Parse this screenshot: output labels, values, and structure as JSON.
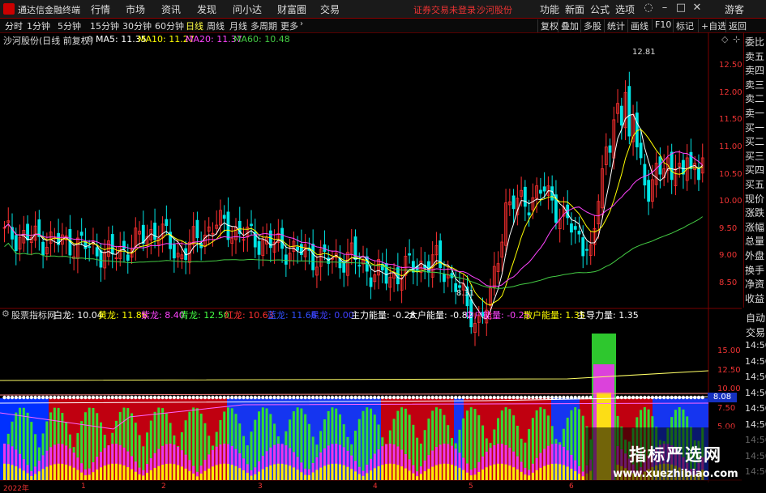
{
  "app": {
    "title": "通达信金融终端"
  },
  "menu": [
    "行情",
    "市场",
    "资讯",
    "发现",
    "问小达",
    "财富圈",
    "交易"
  ],
  "notice": {
    "text": "证券交易未登录",
    "stock": "沙河股份"
  },
  "right_menu": [
    "功能",
    "新面",
    "公式",
    "选项"
  ],
  "guest": "游客",
  "periods": [
    "分时",
    "1分钟",
    "5分钟",
    "15分钟",
    "30分钟",
    "60分钟",
    "日线",
    "周线",
    "月线",
    "多周期",
    "更多"
  ],
  "active_period": "日线",
  "right_tools": [
    "复权",
    "叠加",
    "多股",
    "统计",
    "画线",
    "F10",
    "标记",
    "+自选",
    "返回"
  ],
  "main": {
    "stock_label": "沙河股份(日线 前复权)",
    "ma5": "MA5: 11.35",
    "ma10": "MA10: 11.27",
    "ma20": "MA20: 11.37",
    "ma60": "MA60: 10.48",
    "high_label": "12.81",
    "low_label": "8.31",
    "yaxis": [
      "12.50",
      "12.00",
      "11.50",
      "11.00",
      "10.50",
      "10.00",
      "9.50",
      "9.00",
      "8.50"
    ]
  },
  "sidebar": [
    "委比",
    "卖五",
    "卖四",
    "卖三",
    "卖二",
    "卖一",
    "买一",
    "买二",
    "买三",
    "买四",
    "买五",
    "现价",
    "涨跌",
    "涨幅",
    "总量",
    "外盘",
    "换手",
    "净资",
    "收益"
  ],
  "sidebar2": [
    "自动",
    "交易"
  ],
  "indicator": {
    "name": "股票指标网",
    "items": [
      {
        "label": "白龙: 10.04",
        "color": "#ffffff"
      },
      {
        "label": "黄龙: 11.86",
        "color": "#ffff00"
      },
      {
        "label": "紫龙: 8.40",
        "color": "#ff44ff"
      },
      {
        "label": "青龙: 12.50",
        "color": "#44ff44"
      },
      {
        "label": "红龙: 10.63",
        "color": "#ff3030"
      },
      {
        "label": "蓝龙: 11.66",
        "color": "#3050ff"
      },
      {
        "label": "黑龙: 0.00",
        "color": "#4040ff"
      },
      {
        "label": "主力能量: -0.28",
        "color": "#ffffff"
      },
      {
        "label": "大户能量: -0.82",
        "color": "#ffffff"
      },
      {
        "label": "中户能量: -0.25",
        "color": "#ff44ff"
      },
      {
        "label": "散户能量: 1.35",
        "color": "#ffff00"
      },
      {
        "label": "主导力量: 1.35",
        "color": "#ffffff"
      }
    ],
    "yaxis": [
      "15.00",
      "12.50",
      "10.00",
      "7.50",
      "5.00"
    ],
    "current": "8.08",
    "times": [
      "14:50",
      "14:50",
      "14:50",
      "14:50",
      "14:50",
      "14:50",
      "14:50",
      "14:50",
      "14:50"
    ]
  },
  "xaxis": [
    "2022年",
    "1",
    "2",
    "3",
    "4",
    "5",
    "6"
  ],
  "watermark": {
    "title": "指标严选网",
    "url": "www.xuezhibiao.com"
  },
  "colors": {
    "up": "#ff3030",
    "down": "#00e5e5",
    "ma5": "#ffffff",
    "ma10": "#ffff00",
    "ma20": "#ff44ff",
    "ma60": "#44cc44"
  }
}
